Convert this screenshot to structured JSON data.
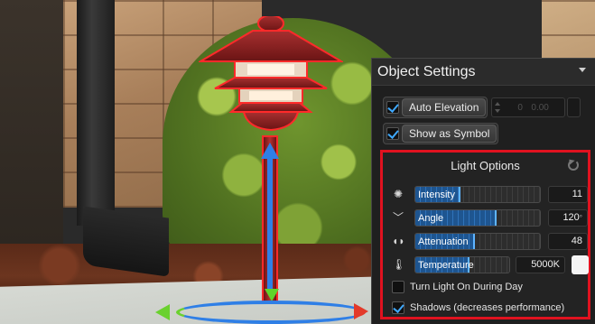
{
  "panel": {
    "title": "Object Settings",
    "auto_elevation": {
      "label": "Auto Elevation",
      "checked": true,
      "value_a": "0",
      "value_b": "0.00"
    },
    "show_as_symbol": {
      "label": "Show as Symbol",
      "checked": true
    }
  },
  "light_options": {
    "title": "Light Options",
    "sliders": [
      {
        "label": "Intensity",
        "value": "11",
        "unit": "",
        "icon": "bulb-icon",
        "level": 0.36
      },
      {
        "label": "Angle",
        "value": "120",
        "unit": "°",
        "icon": "angle-icon",
        "level": 0.65
      },
      {
        "label": "Attenuation",
        "value": "48",
        "unit": "",
        "icon": "attenuation-icon",
        "level": 0.48
      },
      {
        "label": "Temperature",
        "value": "5000K",
        "unit": "",
        "icon": "thermometer-icon",
        "level": 0.58
      }
    ],
    "turn_on_during_day": {
      "label": "Turn Light On During Day",
      "checked": false
    },
    "shadows": {
      "label": "Shadows (decreases performance)",
      "checked": true
    },
    "temperature_color": "#f4f4f4"
  },
  "colors": {
    "accent": "#3fa9ff",
    "highlight_border": "#e0121f",
    "selection_outline": "#ff2a2a"
  }
}
